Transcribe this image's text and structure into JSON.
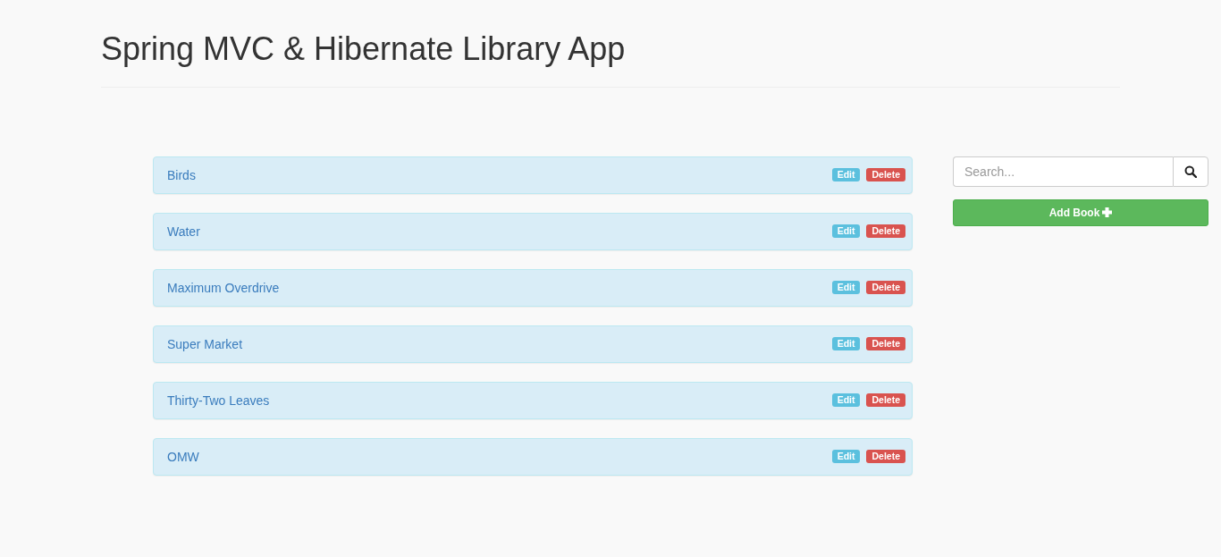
{
  "header": {
    "title": "Spring MVC & Hibernate Library App"
  },
  "books": [
    {
      "title": "Birds",
      "buttons": [
        {
          "kind": "edit",
          "label": "Edit"
        },
        {
          "kind": "delete",
          "label": "Delete"
        }
      ]
    },
    {
      "title": "Water",
      "buttons": [
        {
          "kind": "edit",
          "label": "Edit"
        },
        {
          "kind": "delete",
          "label": "Delete"
        }
      ]
    },
    {
      "title": "Maximum Overdrive",
      "buttons": [
        {
          "kind": "edit",
          "label": "Edit"
        },
        {
          "kind": "delete",
          "label": "Delete"
        }
      ]
    },
    {
      "title": "Super Market",
      "buttons": [
        {
          "kind": "edit",
          "label": "Edit"
        },
        {
          "kind": "delete",
          "label": "Delete"
        }
      ]
    },
    {
      "title": "Thirty-Two Leaves",
      "buttons": [
        {
          "kind": "edit",
          "label": "Edit"
        },
        {
          "kind": "delete",
          "label": "Delete"
        }
      ]
    },
    {
      "title": "OMW",
      "buttons": [
        {
          "kind": "edit",
          "label": "Edit"
        },
        {
          "kind": "delete",
          "label": "Delete"
        }
      ]
    }
  ],
  "sidebar": {
    "search": {
      "placeholder": "Search..."
    },
    "add_button": {
      "label": "Add Book"
    }
  }
}
